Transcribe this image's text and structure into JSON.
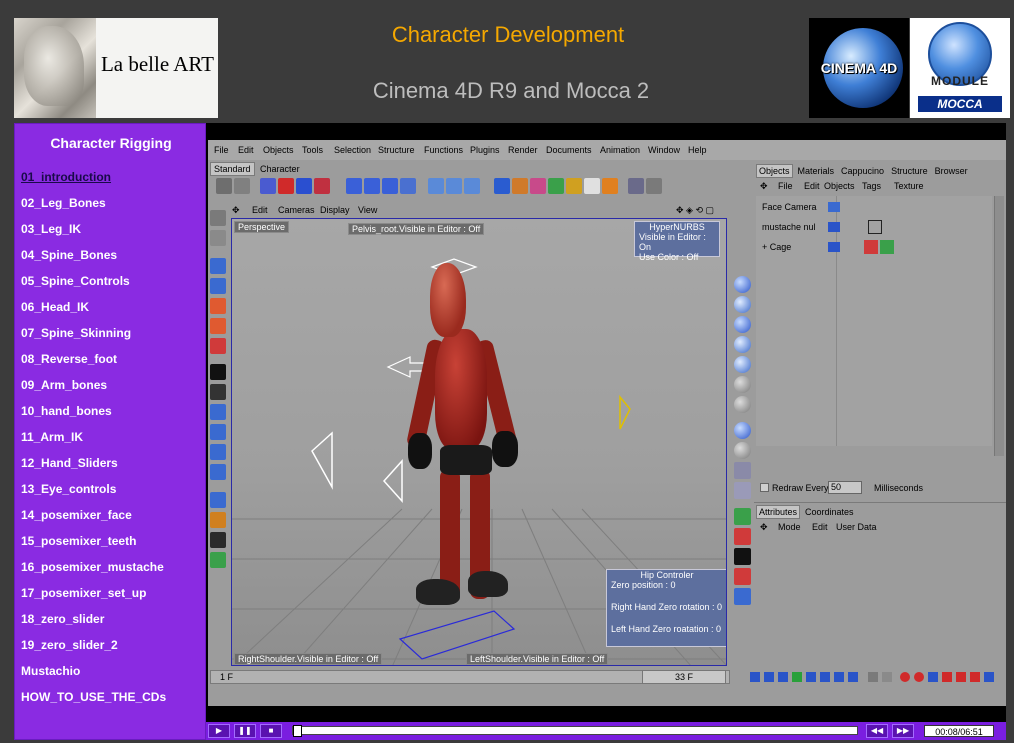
{
  "header": {
    "brand_la": "La",
    "brand_name": "belle ART",
    "title": "Character Development",
    "subtitle": "Cinema 4D R9  and Mocca 2",
    "logo_c4d_text": "CINEMA 4D",
    "logo_module_text": "MODULE",
    "logo_mocca_text": "MOCCA"
  },
  "sidebar": {
    "title": "Character Rigging",
    "items": [
      "01_introduction",
      "02_Leg_Bones",
      "03_Leg_IK",
      "04_Spine_Bones",
      "05_Spine_Controls",
      "06_Head_IK",
      "07_Spine_Skinning",
      "08_Reverse_foot",
      "09_Arm_bones",
      "10_hand_bones",
      "11_Arm_IK",
      "12_Hand_Sliders",
      "13_Eye_controls",
      "14_posemixer_face",
      "15_posemixer_teeth",
      "16_posemixer_mustache",
      "17_posemixer_set_up",
      "18_zero_slider",
      "19_zero_slider_2",
      "Mustachio",
      "HOW_TO_USE_THE_CDs"
    ],
    "active_index": 0
  },
  "app": {
    "menu": [
      "File",
      "Edit",
      "Objects",
      "Tools",
      "Selection",
      "Structure",
      "Functions",
      "Plugins",
      "Render",
      "Documents",
      "Animation",
      "Window",
      "Help"
    ],
    "layout_tabs": [
      "Standard",
      "Character"
    ],
    "viewport_menu": [
      "Edit",
      "Cameras",
      "Display",
      "View"
    ],
    "viewport_name": "Perspective",
    "labels": {
      "pelvis": "Pelvis_root.Visible in Editor : Off",
      "right_shoulder": "RightShoulder.Visible in Editor : Off",
      "left_shoulder": "LeftShoulder.Visible in Editor : Off"
    },
    "hypernurbs": {
      "title": "HyperNURBS",
      "rows": [
        "Visible in Editor : On",
        "Use Color : Off"
      ]
    },
    "hip": {
      "title": "Hip Controler",
      "rows": [
        "Zero position : 0",
        "Right Hand Zero rotation : 0",
        "Left Hand Zero roatation : 0"
      ]
    },
    "frame_start": "1 F",
    "frame_current": "33 F",
    "objects_panel": {
      "tabs": [
        "Objects",
        "Materials",
        "Cappucino",
        "Structure",
        "Browser"
      ],
      "menu": [
        "File",
        "Edit",
        "Objects",
        "Tags",
        "Texture"
      ],
      "rows": [
        "Face Camera",
        "mustache nul",
        "Cage"
      ]
    },
    "redraw": {
      "label": "Redraw Every",
      "value": "50",
      "unit": "Milliseconds"
    },
    "attributes_panel": {
      "tabs": [
        "Attributes",
        "Coordinates"
      ],
      "menu": [
        "Mode",
        "Edit",
        "User Data"
      ]
    }
  },
  "player": {
    "time": "00:08/06:51"
  },
  "colors": {
    "sidebar_bg": "#8a2be2",
    "title_orange": "#f5a800",
    "player_bg": "#7a1ee0"
  }
}
